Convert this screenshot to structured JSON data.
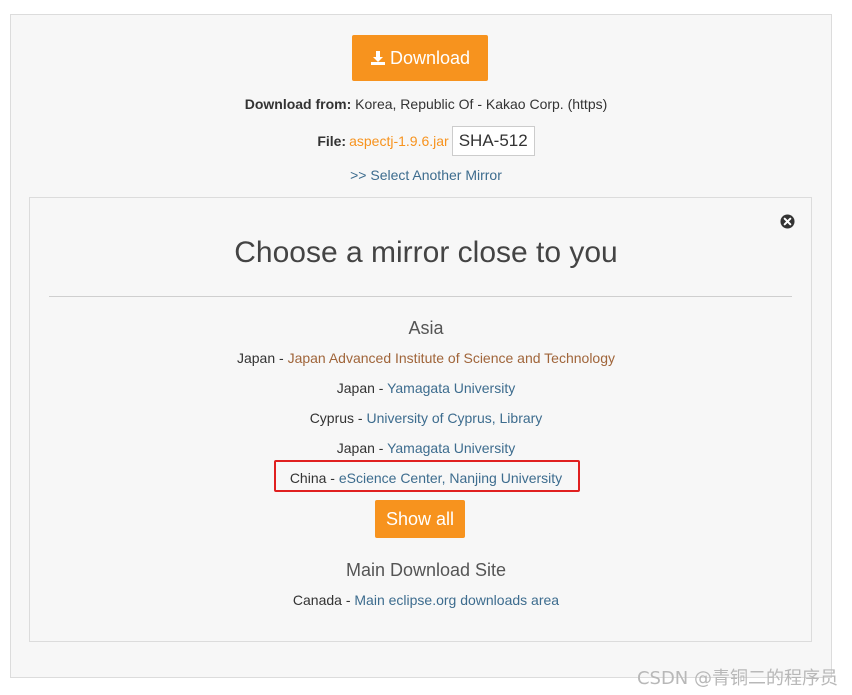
{
  "download": {
    "button_label": "Download"
  },
  "download_from": {
    "label": "Download from:",
    "value": " Korea, Republic Of - Kakao Corp. (https)"
  },
  "file": {
    "label": "File:",
    "name": "aspectj-1.9.6.jar",
    "hash_button": "SHA-512"
  },
  "select_mirror_link": ">> Select Another Mirror",
  "modal": {
    "title": "Choose a mirror close to you",
    "asia": {
      "heading": "Asia",
      "mirrors": [
        {
          "country": "Japan - ",
          "name": "Japan Advanced Institute of Science and Technology"
        },
        {
          "country": "Japan - ",
          "name": "Yamagata University"
        },
        {
          "country": "Cyprus - ",
          "name": "University of Cyprus, Library"
        },
        {
          "country": "Japan - ",
          "name": "Yamagata University"
        },
        {
          "country": "China - ",
          "name": "eScience Center, Nanjing University"
        }
      ]
    },
    "show_all_label": "Show all",
    "main_site": {
      "heading": "Main Download Site",
      "country": "Canada - ",
      "name": "Main eclipse.org downloads area"
    }
  },
  "watermark": "CSDN @青铜二的程序员",
  "colors": {
    "accent": "#f7931e",
    "link": "#3d6c8e",
    "visited_link": "#a0653a",
    "highlight": "#e02020"
  }
}
